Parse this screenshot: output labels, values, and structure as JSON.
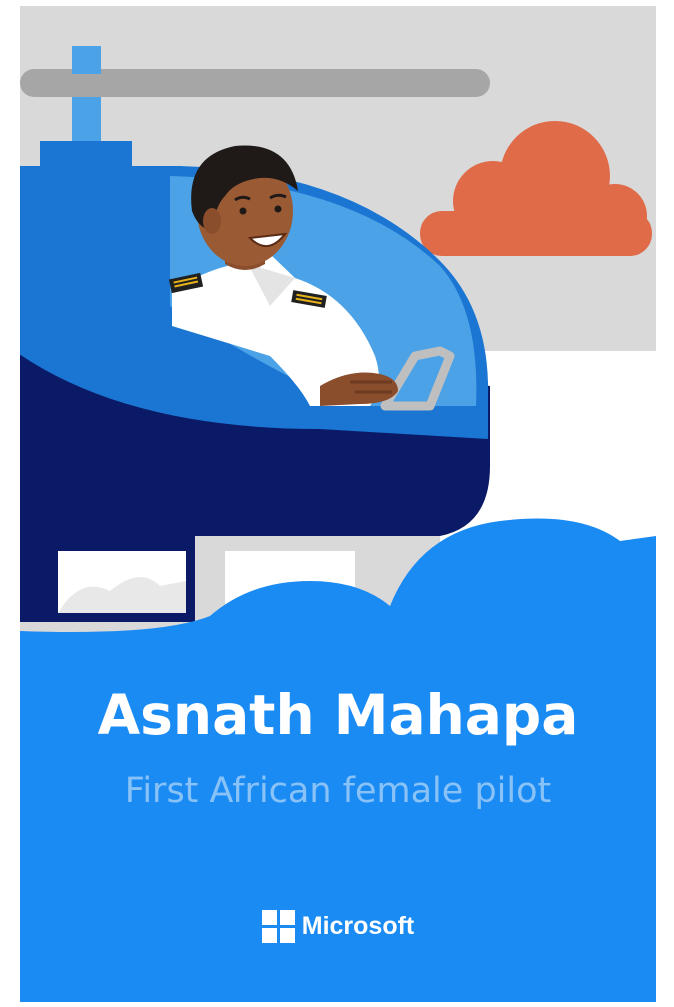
{
  "poster": {
    "name": "Asnath Mahapa",
    "subtitle": "First African female pilot",
    "brand": "Microsoft",
    "icons": [
      "helicopter",
      "pilot",
      "cloud",
      "microsoft-logo"
    ],
    "colors": {
      "sky": "#d9d9d9",
      "cloud_orange": "#e06b49",
      "helicopter_blue": "#1a76d2",
      "helicopter_dark": "#0b1a66",
      "window_blue": "#4ca2e6",
      "panel_blue": "#1b8bf4",
      "subtitle": "#89c2f7"
    }
  }
}
